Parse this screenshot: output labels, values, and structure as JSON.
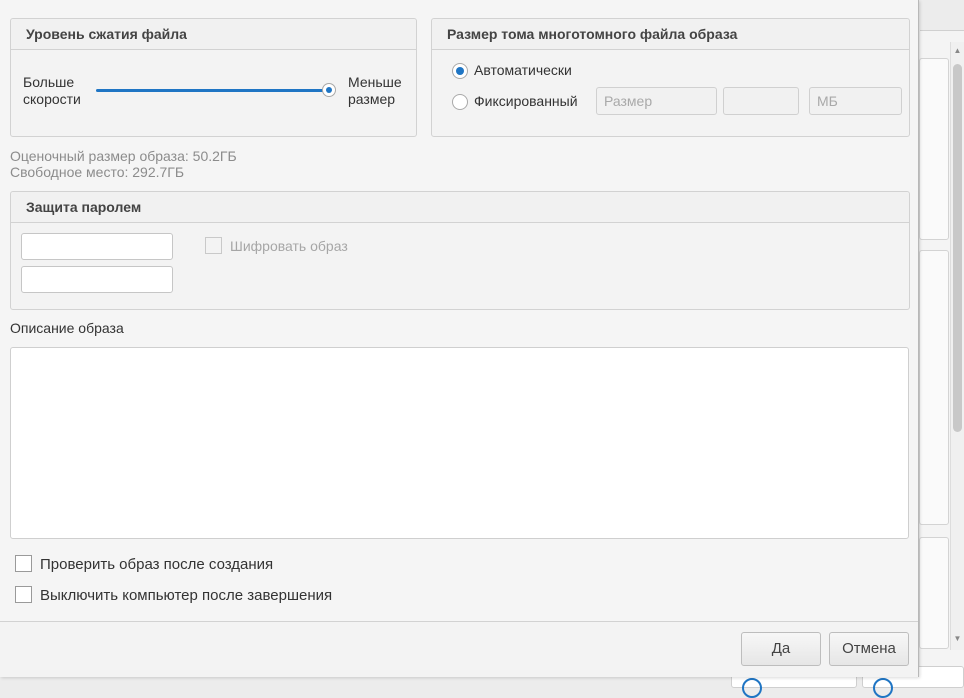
{
  "compression": {
    "title": "Уровень сжатия файла",
    "left_label": [
      "Больше",
      "скорости"
    ],
    "right_label": [
      "Меньше",
      "размер"
    ],
    "level": 1.0
  },
  "volume": {
    "title": "Размер тома многотомного файла образа",
    "auto_label": "Автоматически",
    "fixed_label": "Фиксированный",
    "size_placeholder": "Размер",
    "unit_placeholder": "МБ",
    "selected": "auto"
  },
  "estimate": {
    "size_text": "Оценочный размер образа: 50.2ГБ",
    "free_text": "Свободное место: 292.7ГБ"
  },
  "password": {
    "title": "Защита паролем",
    "encrypt_label": "Шифровать образ"
  },
  "description": {
    "label": "Описание образа",
    "value": ""
  },
  "options": {
    "verify_label": "Проверить  образ после создания",
    "shutdown_label": "Выключить компьютер после завершения"
  },
  "buttons": {
    "ok": "Да",
    "cancel": "Отмена"
  },
  "colors": {
    "accent": "#1f75c4"
  }
}
